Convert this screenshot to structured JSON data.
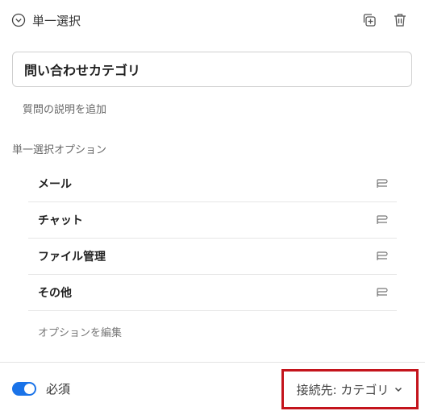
{
  "header": {
    "type_label": "単一選択",
    "icons": [
      "circle-chevron-down-icon",
      "duplicate-icon",
      "trash-icon"
    ]
  },
  "question": {
    "title": "問い合わせカテゴリ",
    "add_description": "質問の説明を追加"
  },
  "options_section": {
    "label": "単一選択オプション",
    "items": [
      {
        "label": "メール"
      },
      {
        "label": "チャット"
      },
      {
        "label": "ファイル管理"
      },
      {
        "label": "その他"
      }
    ],
    "edit_label": "オプションを編集"
  },
  "footer": {
    "required_label": "必須",
    "required_on": true,
    "connection_label": "接続先: カテゴリ"
  },
  "colors": {
    "accent": "#1a73e8",
    "highlight_border": "#c4141c"
  }
}
